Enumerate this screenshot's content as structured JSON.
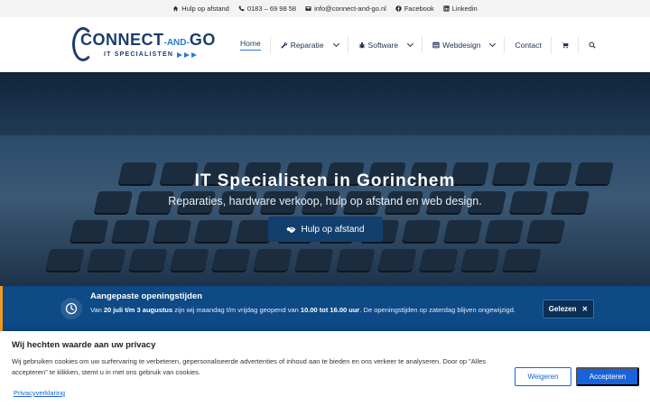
{
  "topbar": {
    "items": [
      {
        "icon": "home-icon",
        "label": "Hulp op afstand"
      },
      {
        "icon": "phone-icon",
        "label": "0183 – 69 98 58"
      },
      {
        "icon": "envelope-icon",
        "label": "info@connect-and-go.nl"
      },
      {
        "icon": "facebook-icon",
        "label": "Facebook"
      },
      {
        "icon": "linkedin-icon",
        "label": "Linkedin"
      }
    ]
  },
  "logo": {
    "main_left": "CONNECT",
    "main_mid": "-AND-",
    "main_right": "GO",
    "sub": "IT SPECIALISTEN"
  },
  "nav": {
    "home": "Home",
    "reparatie": "Reparatie",
    "software": "Software",
    "webdesign": "Webdesign",
    "contact": "Contact"
  },
  "hero": {
    "title": "IT Specialisten in Gorinchem",
    "subtitle": "Reparaties, hardware verkoop, hulp op afstand en web design.",
    "button": "Hulp op afstand"
  },
  "notice": {
    "title": "Aangepaste openingstijden",
    "text_1": "Van ",
    "bold_1": "20 juli t/m 3 augustus",
    "text_2": " zijn wij maandag t/m vrijdag geopend van ",
    "bold_2": "10.00 tot 16.00 uur",
    "text_3": ". De openingstijden op zaterdag blijven ongewijzigd.",
    "button": "Gelezen"
  },
  "cookie": {
    "title": "Wij hechten waarde aan uw privacy",
    "text": "Wij gebruiken cookies om uw surfervaring te verbeteren, gepersonaliseerde advertenties of inhoud aan te bieden en ons verkeer te analyseren. Door op \"Alles accepteren\" te klikken, stemt u in met ons gebruik van cookies.",
    "link": "Privacyverklaring",
    "reject": "Weigeren",
    "accept": "Accepteren"
  },
  "colors": {
    "brand": "#1c3d6e",
    "accent": "#2a7ad1",
    "notice_bg": "#0d4a86",
    "notice_border": "#f29a21",
    "cookie_button": "#1863dc"
  }
}
